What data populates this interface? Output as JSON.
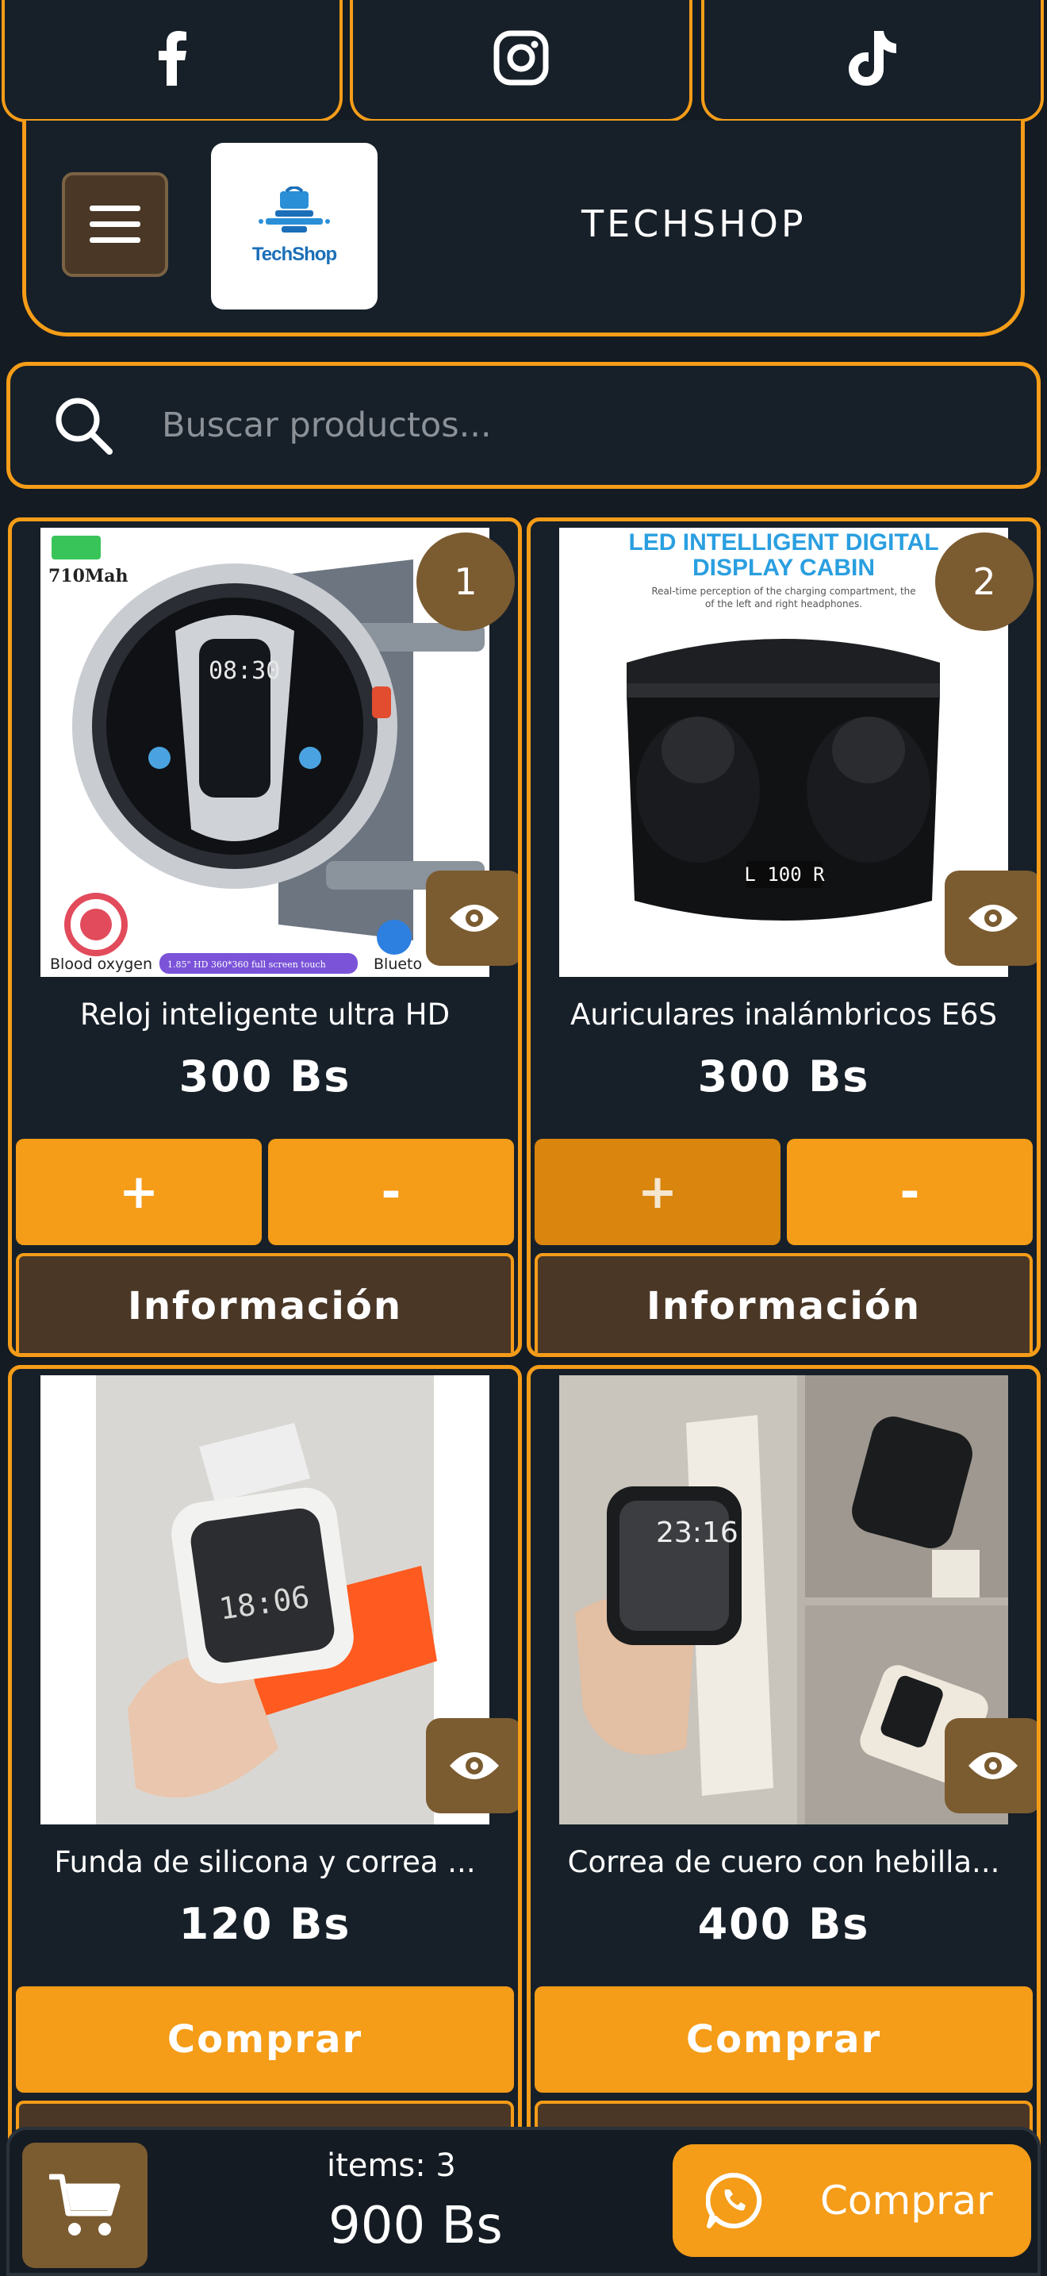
{
  "social": [
    {
      "icon": "facebook-icon"
    },
    {
      "icon": "instagram-icon"
    },
    {
      "icon": "tiktok-icon"
    }
  ],
  "header": {
    "logo_text": "TechShop",
    "brand": "TECHSHOP"
  },
  "search": {
    "placeholder": "Buscar productos..."
  },
  "products": [
    {
      "name": "Reloj inteligente ultra HD",
      "price": "300 Bs",
      "badge": "1",
      "plus_label": "+",
      "minus_label": "-",
      "info_label": "Información",
      "image_text": {
        "battery": "710Mah",
        "bottom_left": "Blood oxygen",
        "bottom_mid": "1.85\" HD 360*360 full screen touch",
        "bottom_right": "Blueto",
        "dial_time": "08:30"
      }
    },
    {
      "name": "Auriculares inalámbricos E6S",
      "price": "300 Bs",
      "badge": "2",
      "plus_label": "+",
      "minus_label": "-",
      "info_label": "Información",
      "image_text": {
        "headline_1": "LED INTELLIGENT DIGITAL",
        "headline_2": "DISPLAY CABIN",
        "subline_1": "Real-time perception of the charging compartment, the",
        "subline_2": "of the left and right headphones.",
        "display": "L 100 R"
      }
    },
    {
      "name": "Funda de silicona y correa ...",
      "price": "120 Bs",
      "buy_label": "Comprar",
      "image_text": {
        "watch_time": "18:06"
      }
    },
    {
      "name": "Correa de cuero con hebilla...",
      "price": "400 Bs",
      "buy_label": "Comprar",
      "image_text": {
        "watch_time": "23:16"
      }
    }
  ],
  "cart": {
    "items_label": "items: 3",
    "total": "900 Bs",
    "checkout_label": "Comprar"
  },
  "colors": {
    "accent": "#f59c18",
    "background": "#141b22",
    "card": "#172029",
    "brown": "#4a3726",
    "badge": "#7b5b30"
  }
}
